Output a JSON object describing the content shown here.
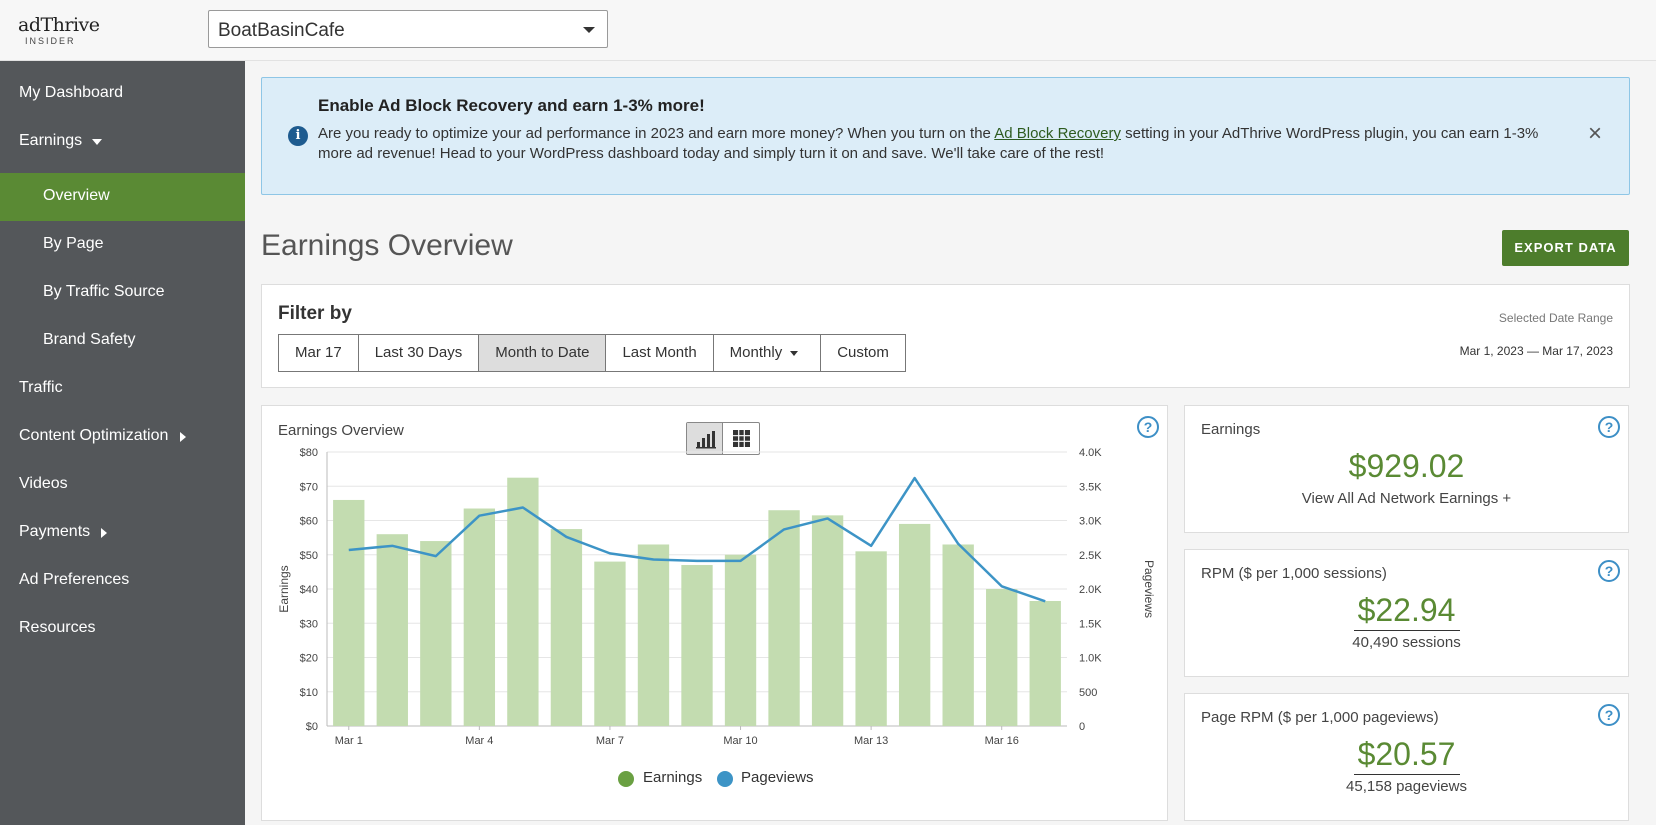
{
  "brand": {
    "logo_main": "adThrive",
    "logo_sub": "INSIDER"
  },
  "site_select": {
    "value": "BoatBasinCafe"
  },
  "sidebar": {
    "items": [
      {
        "label": "My Dashboard"
      },
      {
        "label": "Earnings"
      },
      {
        "label": "Overview"
      },
      {
        "label": "By Page"
      },
      {
        "label": "By Traffic Source"
      },
      {
        "label": "Brand Safety"
      },
      {
        "label": "Traffic"
      },
      {
        "label": "Content Optimization"
      },
      {
        "label": "Videos"
      },
      {
        "label": "Payments"
      },
      {
        "label": "Ad Preferences"
      },
      {
        "label": "Resources"
      }
    ]
  },
  "alert": {
    "title": "Enable Ad Block Recovery and earn 1-3% more!",
    "body_before": "Are you ready to optimize your ad performance in 2023 and earn more money? When you turn on the ",
    "link": "Ad Block Recovery",
    "body_after": " setting in your AdThrive WordPress plugin, you can earn 1-3% more ad revenue! Head to your WordPress dashboard today and simply turn it on and save. We'll take care of the rest!",
    "close": "×"
  },
  "page": {
    "title": "Earnings Overview",
    "export_label": "EXPORT DATA"
  },
  "filter": {
    "label": "Filter by",
    "buttons": [
      "Mar 17",
      "Last 30 Days",
      "Month to Date",
      "Last Month",
      "Monthly",
      "Custom"
    ],
    "active": "Month to Date",
    "range_label": "Selected Date Range",
    "range_value": "Mar 1, 2023 — Mar 17, 2023"
  },
  "chart_panel": {
    "title": "Earnings Overview",
    "help": "?"
  },
  "chart_data": {
    "type": "bar",
    "x": [
      "Mar 1",
      "Mar 2",
      "Mar 3",
      "Mar 4",
      "Mar 5",
      "Mar 6",
      "Mar 7",
      "Mar 8",
      "Mar 9",
      "Mar 10",
      "Mar 11",
      "Mar 12",
      "Mar 13",
      "Mar 14",
      "Mar 15",
      "Mar 16",
      "Mar 17"
    ],
    "x_tick_labels": [
      "Mar 1",
      "Mar 4",
      "Mar 7",
      "Mar 10",
      "Mar 13",
      "Mar 16"
    ],
    "series": [
      {
        "name": "Earnings",
        "type": "bar",
        "axis": "left",
        "color": "#c3dcb0",
        "values": [
          66,
          56,
          54,
          63.5,
          72.5,
          57.5,
          48,
          53,
          47,
          50,
          63,
          61.5,
          51,
          59,
          53,
          40,
          36.5
        ]
      },
      {
        "name": "Pageviews",
        "type": "line",
        "axis": "right",
        "color": "#3d94c6",
        "values": [
          2570,
          2630,
          2480,
          3070,
          3190,
          2760,
          2520,
          2430,
          2410,
          2410,
          2870,
          3030,
          2630,
          3620,
          2660,
          2040,
          1820
        ]
      }
    ],
    "ylabel": "Earnings",
    "y2label": "Pageviews",
    "ylim": [
      0,
      80
    ],
    "y2lim": [
      0,
      4000
    ],
    "y_ticks": [
      "$0",
      "$10",
      "$20",
      "$30",
      "$40",
      "$50",
      "$60",
      "$70",
      "$80"
    ],
    "y2_ticks": [
      "0",
      "500",
      "1.0K",
      "1.5K",
      "2.0K",
      "2.5K",
      "3.0K",
      "3.5K",
      "4.0K"
    ],
    "legend": {
      "position": "bottom",
      "entries": [
        {
          "label": "Earnings",
          "color": "#6aa042"
        },
        {
          "label": "Pageviews",
          "color": "#3d94c6"
        }
      ]
    },
    "grid": true
  },
  "cards": [
    {
      "title": "Earnings",
      "value": "$929.02",
      "sub": "View All Ad Network Earnings +",
      "help": "?"
    },
    {
      "title": "RPM ($ per 1,000 sessions)",
      "value": "$22.94",
      "sub": "40,490 sessions",
      "help": "?"
    },
    {
      "title": "Page RPM ($ per 1,000 pageviews)",
      "value": "$20.57",
      "sub": "45,158 pageviews",
      "help": "?"
    }
  ],
  "colors": {
    "accent_green": "#5a8a34",
    "sidebar_bg": "#54575a",
    "link_blue": "#3d8fc6"
  }
}
